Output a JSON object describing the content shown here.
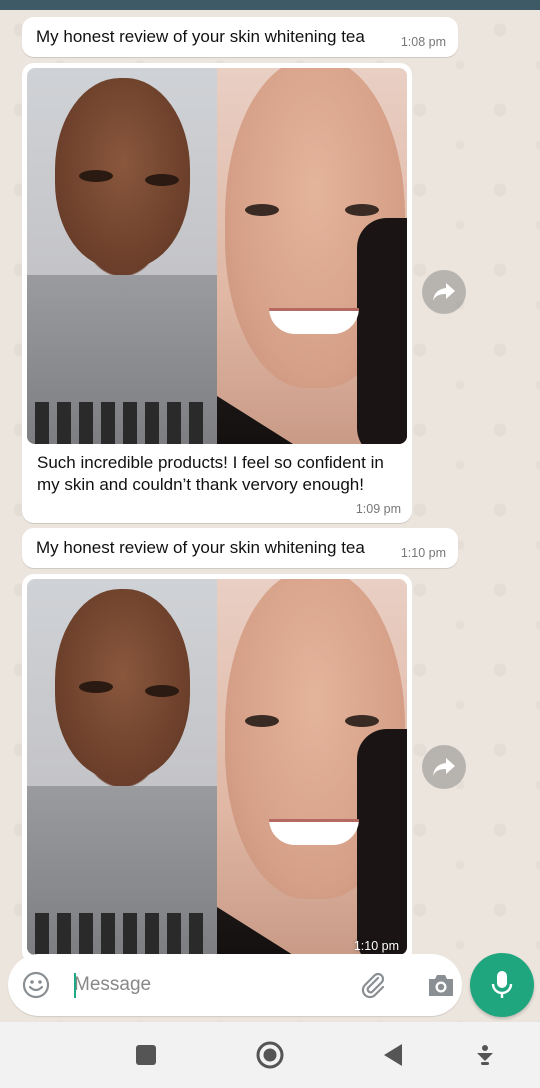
{
  "messages": [
    {
      "text": "My honest review of your skin whitening tea",
      "time": "1:08 pm"
    },
    {
      "caption": "Such incredible products! I feel so confident in my skin and couldn’t thank vervory enough!",
      "time": "1:09 pm"
    },
    {
      "text": "My honest review of your skin whitening tea",
      "time": "1:10 pm"
    },
    {
      "time": "1:10 pm"
    }
  ],
  "input": {
    "placeholder": "Message"
  },
  "icons": {
    "forward": "forward-icon",
    "emoji": "emoji-icon",
    "attach": "paperclip-icon",
    "camera": "camera-icon",
    "mic": "microphone-icon",
    "recents": "square-icon",
    "home": "circle-icon",
    "back": "triangle-back-icon",
    "keyboard": "keyboard-hide-icon"
  },
  "colors": {
    "accent": "#1fa67f",
    "chat_bg": "#ece5dd",
    "bubble": "#ffffff",
    "topbar": "#3d5a66"
  }
}
